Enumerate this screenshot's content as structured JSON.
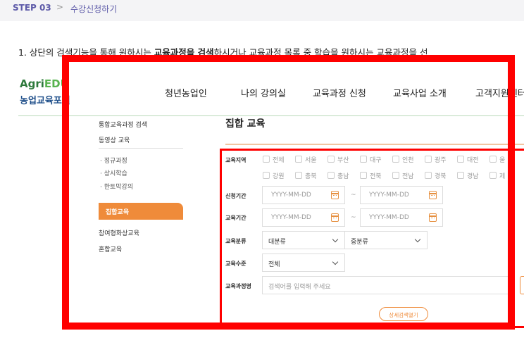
{
  "step": {
    "number": "STEP 03",
    "separator": ">",
    "title": "수강신청하기"
  },
  "instruction": {
    "part1": "1. 상단의 검색기능을 통해 원하시는 ",
    "bold": "교육과정을 검색",
    "part2": "하시거나 교육과정 목록 중 학습을 원하시는 교육과정을 선"
  },
  "logo": {
    "agri": "Agri",
    "edu": "EDU",
    "portal": "농업교육포털"
  },
  "gnb": [
    "청년농업인",
    "나의 강의실",
    "교육과정 신청",
    "교육사업 소개",
    "고객지원센터"
  ],
  "lnb": {
    "items": [
      "통합교육과정 검색",
      "동영상 교육"
    ],
    "sub": [
      "· 정규과정",
      "· 상시학습",
      "· 한토막강의"
    ],
    "active": "집합교육",
    "items2": [
      "참여형화상교육",
      "혼합교육"
    ]
  },
  "main": {
    "title": "집합 교육"
  },
  "form": {
    "region_label": "교육지역",
    "regions_row1": [
      "전체",
      "서울",
      "부산",
      "대구",
      "인천",
      "광주",
      "대전",
      "울"
    ],
    "regions_row2": [
      "강원",
      "충북",
      "충남",
      "전북",
      "전남",
      "경북",
      "경남",
      "제"
    ],
    "apply_period_label": "신청기간",
    "edu_period_label": "교육기간",
    "date_placeholder": "YYYY-MM-DD",
    "tilde": "~",
    "category_label": "교육분류",
    "category_major": "대분류",
    "category_minor": "중분류",
    "level_label": "교육수준",
    "level_value": "전체",
    "course_name_label": "교육과정명",
    "course_name_placeholder": "검색어를 입력해 주세요",
    "detail_button": "상세검색열기"
  },
  "colors": {
    "accent": "#ef8b3a",
    "highlight_frame": "#ff0000",
    "step_text": "#5d5aa8",
    "brand_green": "#2e7a3c"
  }
}
